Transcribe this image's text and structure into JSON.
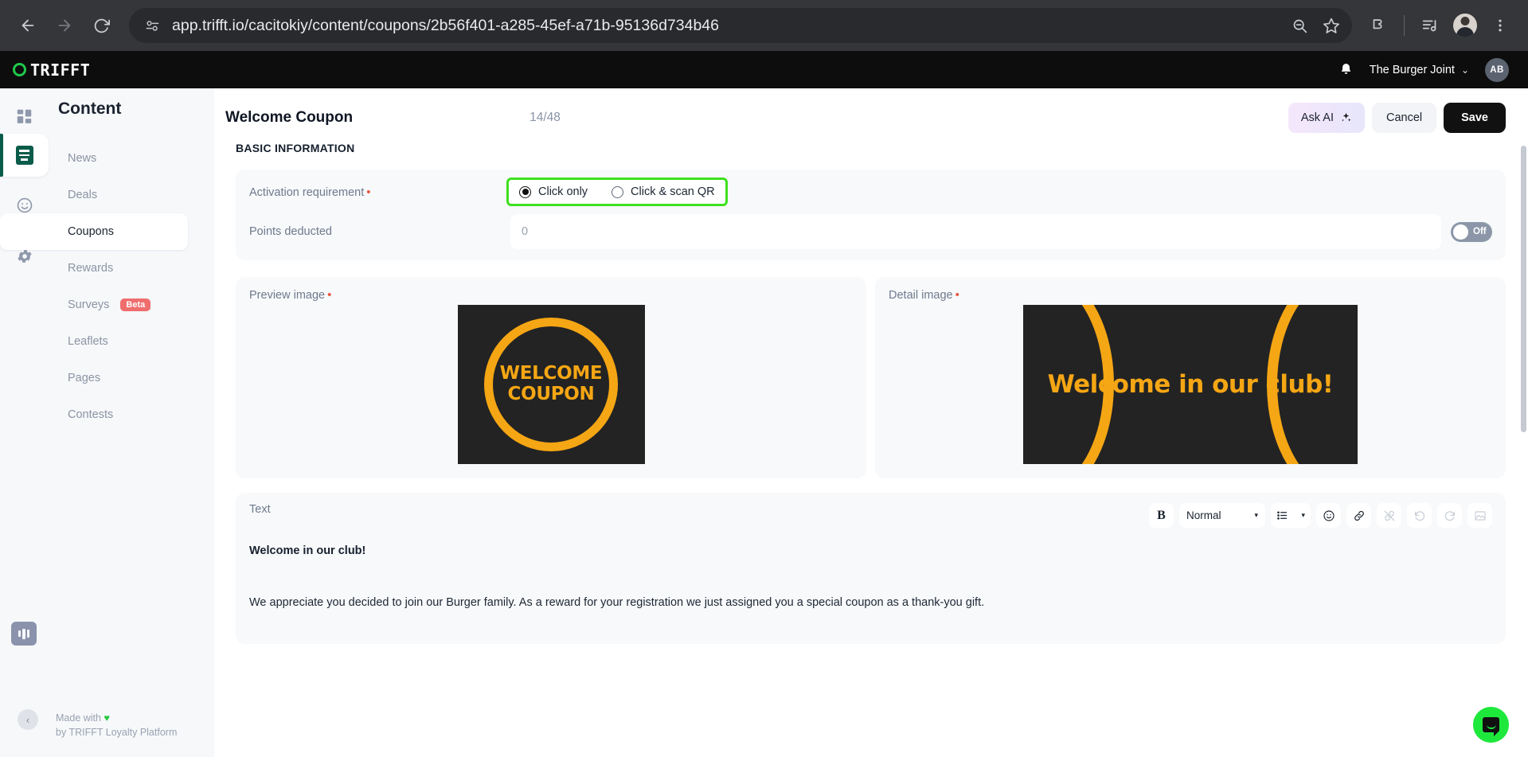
{
  "browser": {
    "url": "app.trifft.io/cacitokiy/content/coupons/2b56f401-a285-45ef-a71b-95136d734b46",
    "back_label": "Back",
    "forward_label": "Forward",
    "reload_label": "Reload",
    "site_info_label": "Site information",
    "search_label": "Search with Google Lens",
    "bookmark_label": "Bookmark this tab",
    "extensions_label": "Extensions",
    "media_label": "Media controls",
    "profile_label": "Profile",
    "menu_label": "Customize and control Chrome"
  },
  "app_header": {
    "brand": "TRIFFT",
    "notifications_label": "Notifications",
    "tenant": "The Burger Joint",
    "tenant_chevron": "⌄",
    "avatar_initials": "AB"
  },
  "sidebar": {
    "title": "Content",
    "items": [
      {
        "label": "News",
        "active": false,
        "badge": null
      },
      {
        "label": "Deals",
        "active": false,
        "badge": null
      },
      {
        "label": "Coupons",
        "active": true,
        "badge": null
      },
      {
        "label": "Rewards",
        "active": false,
        "badge": null
      },
      {
        "label": "Surveys",
        "active": false,
        "badge": "Beta"
      },
      {
        "label": "Leaflets",
        "active": false,
        "badge": null
      },
      {
        "label": "Pages",
        "active": false,
        "badge": null
      },
      {
        "label": "Contests",
        "active": false,
        "badge": null
      }
    ],
    "rail_icons": [
      "dashboard-icon",
      "content-icon",
      "engagement-icon",
      "settings-icon",
      "analytics-icon"
    ],
    "footer": {
      "made_with": "Made with",
      "heart": "♥",
      "by_line": "by TRIFFT Loyalty Platform",
      "collapse_label": "‹"
    }
  },
  "page": {
    "title": "Welcome Coupon",
    "count": "14/48",
    "actions": {
      "ask_ai": "Ask AI",
      "cancel": "Cancel",
      "save": "Save"
    },
    "section_label": "BASIC INFORMATION"
  },
  "basic_information": {
    "activation": {
      "label": "Activation requirement",
      "required": "•",
      "options": [
        {
          "label": "Click only",
          "selected": true
        },
        {
          "label": "Click & scan QR",
          "selected": false
        }
      ],
      "highlighted": true,
      "highlight_color": "#3ee01e"
    },
    "points_deducted": {
      "label": "Points deducted",
      "value": "",
      "placeholder": "0",
      "toggle_state": "Off"
    }
  },
  "images": {
    "preview": {
      "label": "Preview image",
      "required": "•",
      "line1": "WELCOME",
      "line2": "COUPON",
      "bg_color": "#232323",
      "accent_color": "#f5a614"
    },
    "detail": {
      "label": "Detail image",
      "required": "•",
      "text": "Welcome in our club!",
      "bg_color": "#232323",
      "accent_color": "#f5a614"
    }
  },
  "text_editor": {
    "label": "Text",
    "toolbar": {
      "bold": "B",
      "format": "Normal",
      "list_label": "List",
      "emoji_label": "Emoji",
      "link_label": "Insert link",
      "unlink_label": "Remove link",
      "undo_label": "Undo",
      "redo_label": "Redo",
      "image_label": "Insert image",
      "caret": "▾"
    },
    "content": {
      "heading": "Welcome in our club!",
      "paragraph": "We appreciate you decided to join our Burger family. As a reward for your registration we just assigned you a special coupon as a thank-you gift."
    }
  },
  "chat_widget": {
    "label": "Open chat",
    "color": "#1ee83c"
  }
}
